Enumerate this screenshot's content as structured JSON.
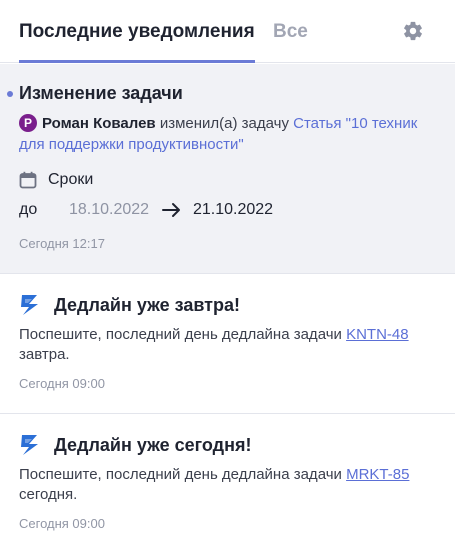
{
  "header": {
    "tab_active": "Последние уведомления",
    "tab_all": "Все",
    "settings_icon": "gear-icon"
  },
  "colors": {
    "accent": "#6b7bd6",
    "link": "#5b6fd6",
    "avatar": "#7a1f8c",
    "brand": "#2b6fd6",
    "unread_bg": "#f1f2f6"
  },
  "notifications": [
    {
      "unread": true,
      "title": "Изменение задачи",
      "avatar_letter": "Р",
      "author": "Роман Ковалев",
      "action": "изменил(а) задачу",
      "task_link": "Статья \"10 техник для поддержки продуктивности\"",
      "field_icon": "calendar-icon",
      "field_label": "Сроки",
      "to_label": "до",
      "old_value": "18.10.2022",
      "new_value": "21.10.2022",
      "time": "Сегодня 12:17"
    },
    {
      "unread": false,
      "icon": "brand-logo-icon",
      "title": "Дедлайн уже завтра!",
      "text_before": "Поспешите, последний день дедлайна задачи ",
      "ticket": "KNTN-48",
      "text_after": " завтра.",
      "time": "Сегодня 09:00"
    },
    {
      "unread": false,
      "icon": "brand-logo-icon",
      "title": "Дедлайн уже сегодня!",
      "text_before": "Поспешите, последний день дедлайна задачи ",
      "ticket": "MRKT-85",
      "text_after": " сегодня.",
      "time": "Сегодня 09:00"
    }
  ]
}
